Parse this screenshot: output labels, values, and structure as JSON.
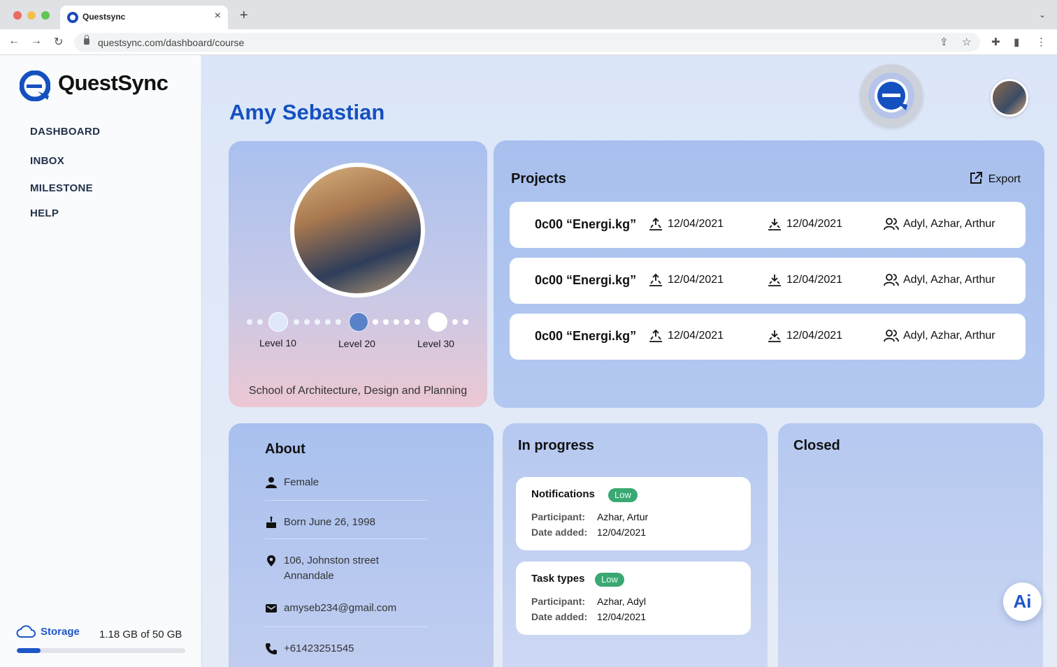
{
  "browser": {
    "tab_title": "Questsync",
    "url": "questsync.com/dashboard/course"
  },
  "brand": {
    "name": "QuestSync",
    "accent": "#1550c0"
  },
  "sidebar": {
    "items": [
      {
        "label": "DASHBOARD"
      },
      {
        "label": "INBOX"
      },
      {
        "label": "MILESTONE"
      },
      {
        "label": "HELP"
      }
    ],
    "storage": {
      "label": "Storage",
      "value": "1.18 GB of 50 GB",
      "fraction_used": 0.14
    }
  },
  "profile": {
    "name": "Amy Sebastian",
    "school": "School of Architecture, Design and Planning",
    "levels": [
      "Level 10",
      "Level 20",
      "Level 30"
    ],
    "current_level_index": 1
  },
  "projects": {
    "title": "Projects",
    "export_label": "Export",
    "rows": [
      {
        "name": "0c00 “Energi.kg”",
        "start": "12/04/2021",
        "end": "12/04/2021",
        "team": "Adyl, Azhar, Arthur"
      },
      {
        "name": "0c00 “Energi.kg”",
        "start": "12/04/2021",
        "end": "12/04/2021",
        "team": "Adyl, Azhar, Arthur"
      },
      {
        "name": "0c00 “Energi.kg”",
        "start": "12/04/2021",
        "end": "12/04/2021",
        "team": "Adyl, Azhar, Arthur"
      }
    ]
  },
  "about": {
    "title": "About",
    "gender": "Female",
    "birth": "Born June 26, 1998",
    "address_line1": "106, Johnston street",
    "address_line2": "Annandale",
    "email": "amyseb234@gmail.com",
    "phone": "+61423251545"
  },
  "in_progress": {
    "title": "In progress",
    "participant_label": "Participant:",
    "date_label": "Date added:",
    "tasks": [
      {
        "name": "Notifications",
        "priority": "Low",
        "participant": "Azhar, Artur",
        "date": "12/04/2021"
      },
      {
        "name": "Task types",
        "priority": "Low",
        "participant": "Azhar, Adyl",
        "date": "12/04/2021"
      }
    ]
  },
  "closed": {
    "title": "Closed"
  },
  "ai_button": {
    "label": "Ai"
  }
}
